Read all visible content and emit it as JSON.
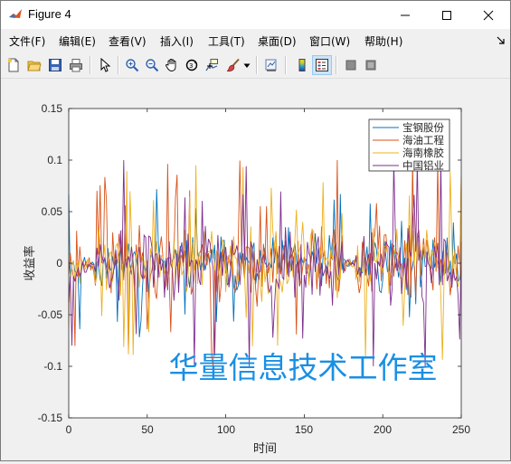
{
  "window": {
    "title": "Figure 4"
  },
  "menu": {
    "items": [
      "文件(F)",
      "编辑(E)",
      "查看(V)",
      "插入(I)",
      "工具(T)",
      "桌面(D)",
      "窗口(W)",
      "帮助(H)"
    ]
  },
  "toolbar": {
    "icons": [
      "new-figure-icon",
      "open-file-icon",
      "save-icon",
      "print-icon",
      "pointer-icon",
      "zoom-in-icon",
      "zoom-out-icon",
      "pan-icon",
      "rotate-3d-icon",
      "data-cursor-icon",
      "brush-icon",
      "link-plot-icon",
      "colorbar-icon",
      "legend-icon",
      "hide-plot-tools-icon",
      "show-plot-tools-icon"
    ]
  },
  "chart_data": {
    "type": "line",
    "title": "",
    "xlabel": "时间",
    "ylabel": "收益率",
    "xlim": [
      0,
      250
    ],
    "ylim": [
      -0.15,
      0.15
    ],
    "xticks": [
      "0",
      "50",
      "100",
      "150",
      "200",
      "250"
    ],
    "yticks": [
      "0.15",
      "0.1",
      "0.05",
      "0",
      "-0.05",
      "-0.1",
      "-0.15"
    ],
    "legend_position": "top-right",
    "grid": false,
    "series": [
      {
        "name": "宝钢股份",
        "color": "#0072bd",
        "seed": 11,
        "scale": 0.026,
        "spike": 0.06
      },
      {
        "name": "海油工程",
        "color": "#d95319",
        "seed": 23,
        "scale": 0.034,
        "spike": 0.09
      },
      {
        "name": "海南橡胶",
        "color": "#edb120",
        "seed": 37,
        "scale": 0.031,
        "spike": 0.08
      },
      {
        "name": "中国铝业",
        "color": "#7e2f8e",
        "seed": 53,
        "scale": 0.036,
        "spike": 0.1
      }
    ],
    "clip": [
      -0.1,
      0.1
    ],
    "n_points": 250,
    "watermark": "华量信息技术工作室",
    "watermark_color": "#1a8fe3"
  }
}
